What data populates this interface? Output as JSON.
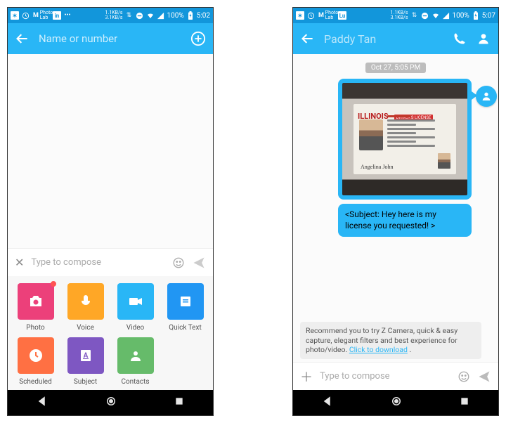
{
  "status": {
    "net": "1.1KB/s\n3.1KB/s",
    "battery": "100%",
    "time_left": "5:02",
    "time_right": "5:07"
  },
  "left": {
    "header": {
      "placeholder": "Name or number"
    },
    "compose": {
      "placeholder": "Type to compose"
    },
    "attachments": [
      {
        "key": "photo",
        "label": "Photo"
      },
      {
        "key": "voice",
        "label": "Voice"
      },
      {
        "key": "video",
        "label": "Video"
      },
      {
        "key": "quick",
        "label": "Quick Text"
      },
      {
        "key": "sched",
        "label": "Scheduled"
      },
      {
        "key": "subj",
        "label": "Subject"
      },
      {
        "key": "cont",
        "label": "Contacts"
      }
    ]
  },
  "right": {
    "header": {
      "contact_name": "Paddy Tan"
    },
    "timestamp": "Oct 27, 5:05 PM",
    "id_card": {
      "state": "ILLINOIS",
      "banner": "DRIVER'S LICENSE",
      "signature": "Angelina John"
    },
    "message_subject": "<Subject: Hey here is my license you requested! >",
    "promo": {
      "text": "Recommend you to try Z Camera, quick & easy capture, elegant filters and best experience for photo/video. ",
      "link": "Click to download",
      "trail": " ."
    },
    "compose": {
      "placeholder": "Type to compose"
    }
  }
}
